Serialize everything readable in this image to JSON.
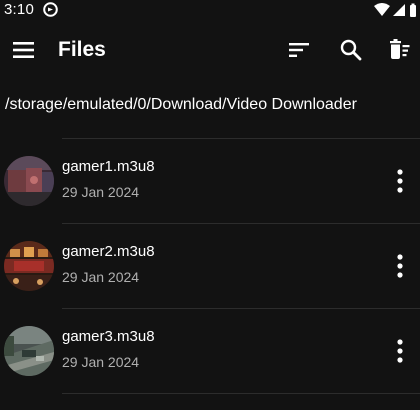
{
  "status_bar": {
    "time": "3:10",
    "icons": [
      "app-notification-icon",
      "wifi-icon",
      "signal-icon",
      "battery-icon"
    ]
  },
  "app_bar": {
    "title": "Files",
    "actions": [
      "sort-icon",
      "search-icon",
      "delete-all-icon"
    ],
    "menu_icon": "hamburger-menu-icon"
  },
  "current_path": "/storage/emulated/0/Download/Video Downloader",
  "files": [
    {
      "name": "gamer1.m3u8",
      "date": "29 Jan 2024",
      "menu_icon": "more-vertical-icon"
    },
    {
      "name": "gamer2.m3u8",
      "date": "29 Jan 2024",
      "menu_icon": "more-vertical-icon"
    },
    {
      "name": "gamer3.m3u8",
      "date": "29 Jan 2024",
      "menu_icon": "more-vertical-icon"
    }
  ],
  "colors": {
    "background": "#121212",
    "text_primary": "#ffffff",
    "text_secondary": "#b0b0b0",
    "divider": "#2c2c2c"
  }
}
